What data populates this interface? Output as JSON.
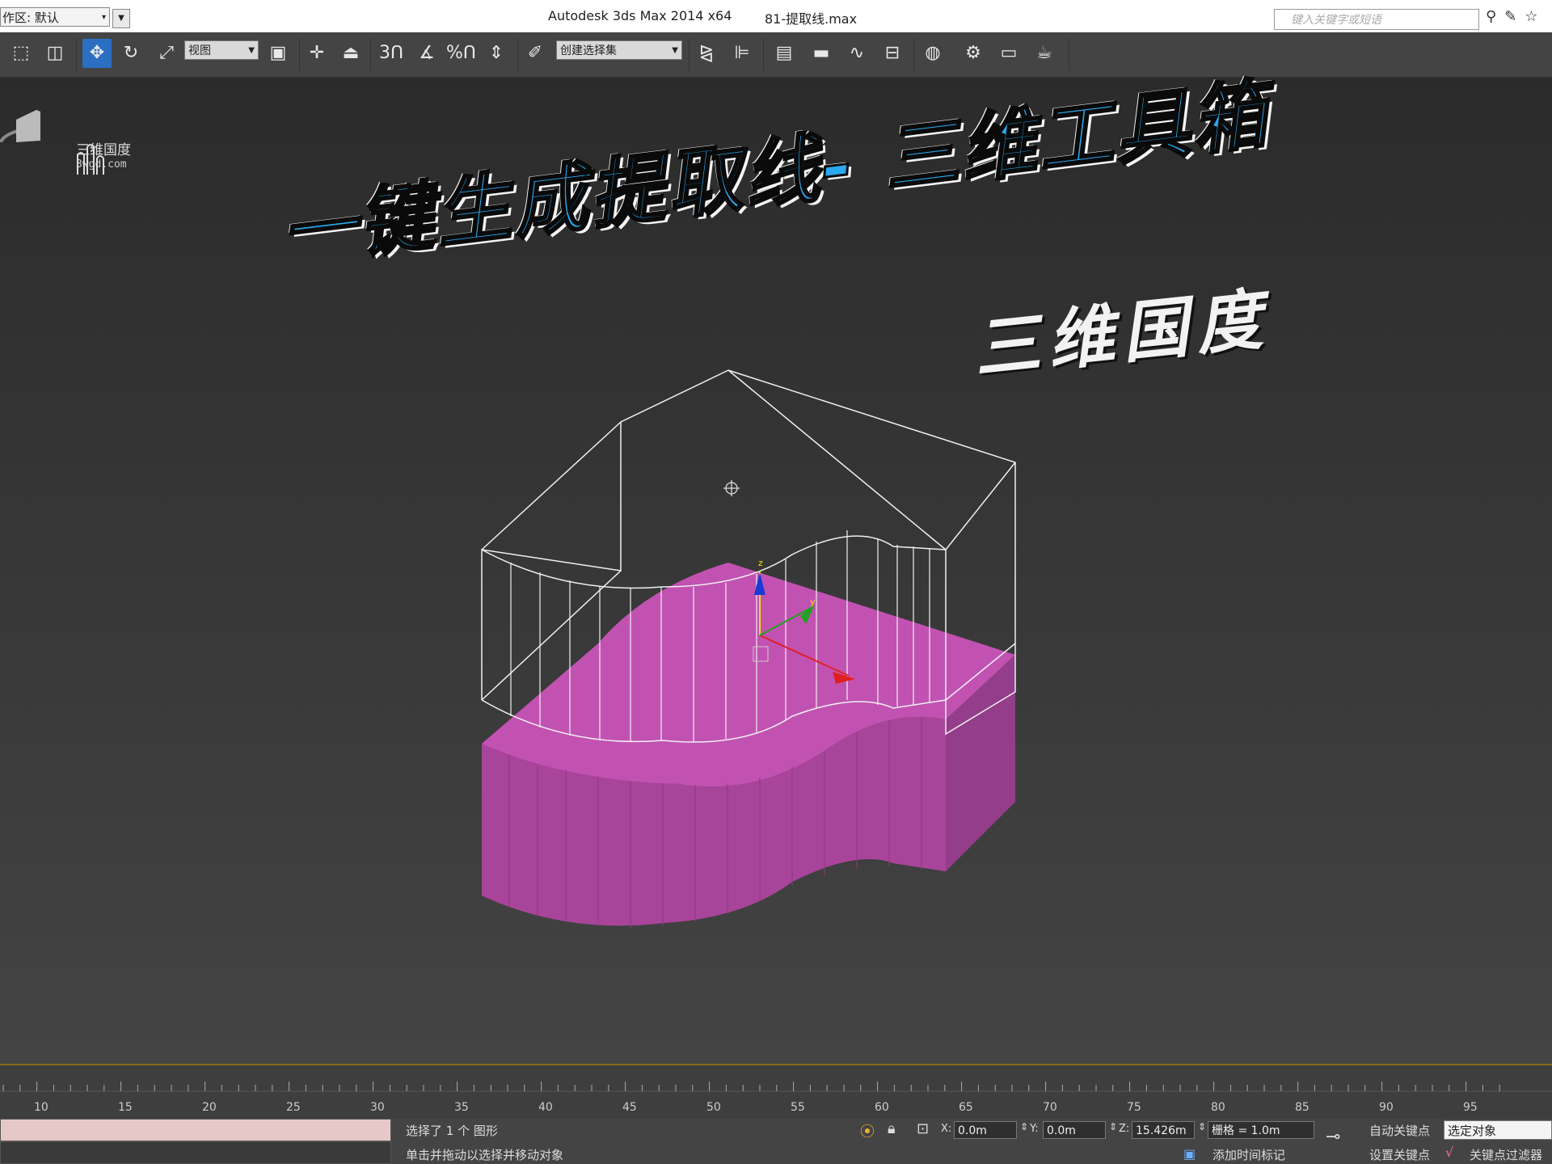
{
  "titlebar": {
    "workspace_label": "作区: 默认",
    "app_title": "Autodesk 3ds Max  2014 x64",
    "file_title": "81-提取线.max",
    "search_placeholder": "键入关键字或短语"
  },
  "toolbar": {
    "view_dropdown": "视图",
    "selection_set_dropdown": "创建选择集",
    "snap_3": "3",
    "percent_snap": "%"
  },
  "viewport": {
    "logo_name": "三维国度",
    "logo_url": "3wgd.com",
    "headline": "一键生成提取线- 三维工具箱",
    "subhead": "三维国度",
    "gizmo_axis_z": "z",
    "gizmo_axis_y": "y",
    "colors": {
      "object": "#c04fae",
      "wireframe": "#ffffff",
      "headline": "#2aa8f0"
    }
  },
  "timeline": {
    "ticks": [
      "10",
      "15",
      "20",
      "25",
      "30",
      "35",
      "40",
      "45",
      "50",
      "55",
      "60",
      "65",
      "70",
      "75",
      "80",
      "85",
      "90",
      "95"
    ]
  },
  "status": {
    "selection_info": "选择了 1 个 图形",
    "prompt": "单击并拖动以选择并移动对象",
    "x_label": "X:",
    "x_value": "0.0m",
    "y_label": "Y:",
    "y_value": "0.0m",
    "z_label": "Z:",
    "z_value": "15.426m",
    "grid": "栅格 = 1.0m",
    "add_time_tag": "添加时间标记",
    "auto_key": "自动关键点",
    "set_key": "设置关键点",
    "selected_object": "选定对象",
    "key_filters": "关键点过滤器"
  }
}
